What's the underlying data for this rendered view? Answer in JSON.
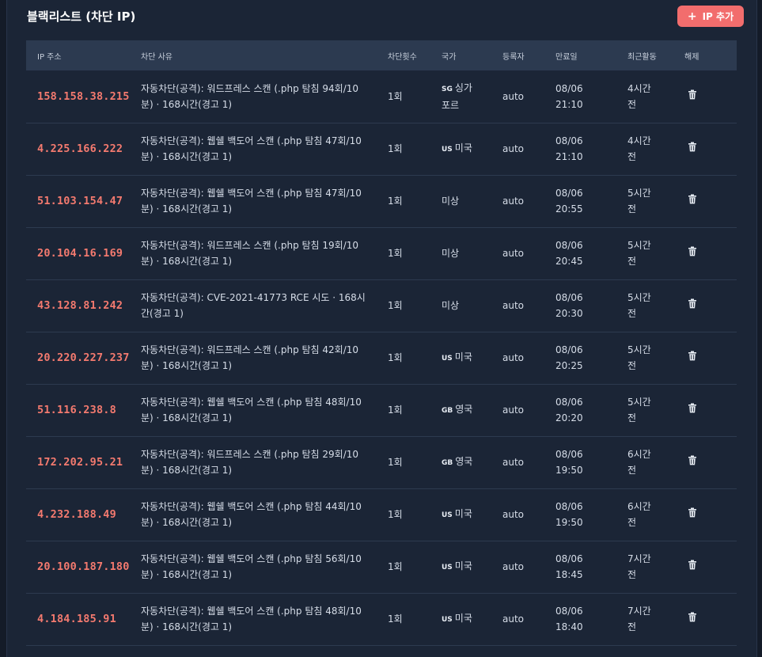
{
  "panel": {
    "title": "블랙리스트 (차단 IP)",
    "add_button_label": "IP 추가",
    "add_button_icon": "+"
  },
  "table": {
    "headers": {
      "ip": "IP 주소",
      "reason": "차단 사유",
      "count": "차단횟수",
      "country": "국가",
      "registrant": "등록자",
      "expires": "만료일",
      "last_activity": "최근활동",
      "release": "해제"
    },
    "rows": [
      {
        "ip": "158.158.38.215",
        "reason_line1": "자동차단(공격): 워드프레스 스캔 (.php 탐침 94회/10",
        "reason_line2": "분) · 168시간(경고 1)",
        "count": "1회",
        "cc": "SG",
        "country_line1": "싱가",
        "country_line2": "포르",
        "registrant": "auto",
        "date": "08/06",
        "time": "21:10",
        "ago_line1": "4시간",
        "ago_line2": "전"
      },
      {
        "ip": "4.225.166.222",
        "reason_line1": "자동차단(공격): 웹쉘 백도어 스캔 (.php 탐침 47회/10",
        "reason_line2": "분) · 168시간(경고 1)",
        "count": "1회",
        "cc": "US",
        "country_line1": "미국",
        "country_line2": "",
        "registrant": "auto",
        "date": "08/06",
        "time": "21:10",
        "ago_line1": "4시간",
        "ago_line2": "전"
      },
      {
        "ip": "51.103.154.47",
        "reason_line1": "자동차단(공격): 웹쉘 백도어 스캔 (.php 탐침 47회/10",
        "reason_line2": "분) · 168시간(경고 1)",
        "count": "1회",
        "cc": "",
        "country_line1": "미상",
        "country_line2": "",
        "registrant": "auto",
        "date": "08/06",
        "time": "20:55",
        "ago_line1": "5시간",
        "ago_line2": "전"
      },
      {
        "ip": "20.104.16.169",
        "reason_line1": "자동차단(공격): 워드프레스 스캔 (.php 탐침 19회/10",
        "reason_line2": "분) · 168시간(경고 1)",
        "count": "1회",
        "cc": "",
        "country_line1": "미상",
        "country_line2": "",
        "registrant": "auto",
        "date": "08/06",
        "time": "20:45",
        "ago_line1": "5시간",
        "ago_line2": "전"
      },
      {
        "ip": "43.128.81.242",
        "reason_line1": "자동차단(공격): CVE-2021-41773 RCE 시도 · 168시",
        "reason_line2": "간(경고 1)",
        "count": "1회",
        "cc": "",
        "country_line1": "미상",
        "country_line2": "",
        "registrant": "auto",
        "date": "08/06",
        "time": "20:30",
        "ago_line1": "5시간",
        "ago_line2": "전"
      },
      {
        "ip": "20.220.227.237",
        "reason_line1": "자동차단(공격): 워드프레스 스캔 (.php 탐침 42회/10",
        "reason_line2": "분) · 168시간(경고 1)",
        "count": "1회",
        "cc": "US",
        "country_line1": "미국",
        "country_line2": "",
        "registrant": "auto",
        "date": "08/06",
        "time": "20:25",
        "ago_line1": "5시간",
        "ago_line2": "전"
      },
      {
        "ip": "51.116.238.8",
        "reason_line1": "자동차단(공격): 웹쉘 백도어 스캔 (.php 탐침 48회/10",
        "reason_line2": "분) · 168시간(경고 1)",
        "count": "1회",
        "cc": "GB",
        "country_line1": "영국",
        "country_line2": "",
        "registrant": "auto",
        "date": "08/06",
        "time": "20:20",
        "ago_line1": "5시간",
        "ago_line2": "전"
      },
      {
        "ip": "172.202.95.21",
        "reason_line1": "자동차단(공격): 워드프레스 스캔 (.php 탐침 29회/10",
        "reason_line2": "분) · 168시간(경고 1)",
        "count": "1회",
        "cc": "GB",
        "country_line1": "영국",
        "country_line2": "",
        "registrant": "auto",
        "date": "08/06",
        "time": "19:50",
        "ago_line1": "6시간",
        "ago_line2": "전"
      },
      {
        "ip": "4.232.188.49",
        "reason_line1": "자동차단(공격): 웹쉘 백도어 스캔 (.php 탐침 44회/10",
        "reason_line2": "분) · 168시간(경고 1)",
        "count": "1회",
        "cc": "US",
        "country_line1": "미국",
        "country_line2": "",
        "registrant": "auto",
        "date": "08/06",
        "time": "19:50",
        "ago_line1": "6시간",
        "ago_line2": "전"
      },
      {
        "ip": "20.100.187.180",
        "reason_line1": "자동차단(공격): 웹쉘 백도어 스캔 (.php 탐침 56회/10",
        "reason_line2": "분) · 168시간(경고 1)",
        "count": "1회",
        "cc": "US",
        "country_line1": "미국",
        "country_line2": "",
        "registrant": "auto",
        "date": "08/06",
        "time": "18:45",
        "ago_line1": "7시간",
        "ago_line2": "전"
      },
      {
        "ip": "4.184.185.91",
        "reason_line1": "자동차단(공격): 웹쉘 백도어 스캔 (.php 탐침 48회/10",
        "reason_line2": "분) · 168시간(경고 1)",
        "count": "1회",
        "cc": "US",
        "country_line1": "미국",
        "country_line2": "",
        "registrant": "auto",
        "date": "08/06",
        "time": "18:40",
        "ago_line1": "7시간",
        "ago_line2": "전"
      }
    ]
  },
  "icons": {
    "delete": "trash-icon",
    "add": "plus-icon"
  },
  "colors": {
    "ip": "#f47a6f",
    "accent_button": "#f26d6d",
    "panel_bg": "#1b2536",
    "header_bg": "#2c3a50"
  }
}
